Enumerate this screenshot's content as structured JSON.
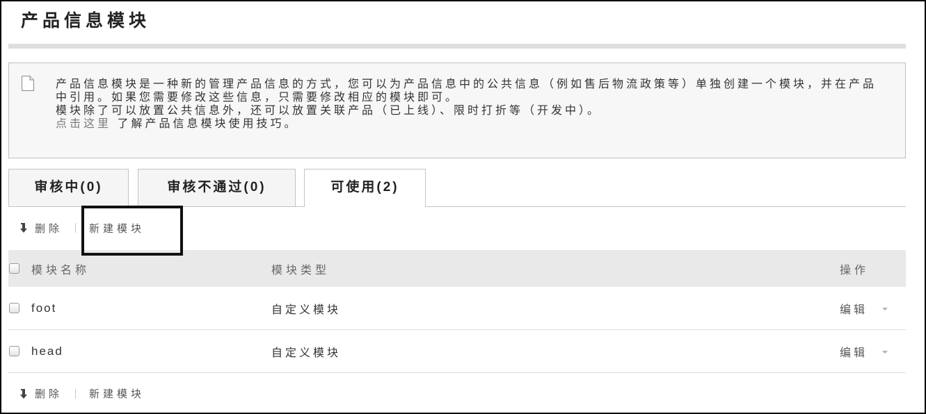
{
  "page": {
    "title": "产品信息模块"
  },
  "info": {
    "icon": "document-icon",
    "lines": [
      "产品信息模块是一种新的管理产品信息的方式，您可以为产品信息中的公共信息（例如售后物流政策等）单独创建一个模块，并在产品",
      "中引用。如果您需要修改这些信息，只需要修改相应的模块即可。",
      "模块除了可以放置公共信息外，还可以放置关联产品（已上线）、限时打折等（开发中）。"
    ],
    "link_text": "点击这里",
    "link_suffix": " 了解产品信息模块使用技巧。"
  },
  "tabs": [
    {
      "label": "审核中(0)",
      "active": false
    },
    {
      "label": "审核不通过(0)",
      "active": false
    },
    {
      "label": "可使用(2)",
      "active": true
    }
  ],
  "toolbar_top": {
    "delete_icon": "arrow-down-icon",
    "delete_label": "删除",
    "new_label": "新建模块"
  },
  "table": {
    "columns": [
      "模块名称",
      "模块类型",
      "操作"
    ],
    "select_all_checked": false,
    "rows": [
      {
        "name": "foot",
        "type": "自定义模块",
        "action": "编辑",
        "action_icon": "caret-down-icon",
        "checked": false
      },
      {
        "name": "head",
        "type": "自定义模块",
        "action": "编辑",
        "action_icon": "caret-down-icon",
        "checked": false
      }
    ]
  },
  "toolbar_bottom": {
    "delete_icon": "arrow-down-icon",
    "delete_label": "删除",
    "new_label": "新建模块"
  },
  "colors": {
    "link": "#7a7a7a",
    "info_bg": "#f7f7f7",
    "header_bg": "#e9e9e9",
    "annotation": "#111111"
  }
}
